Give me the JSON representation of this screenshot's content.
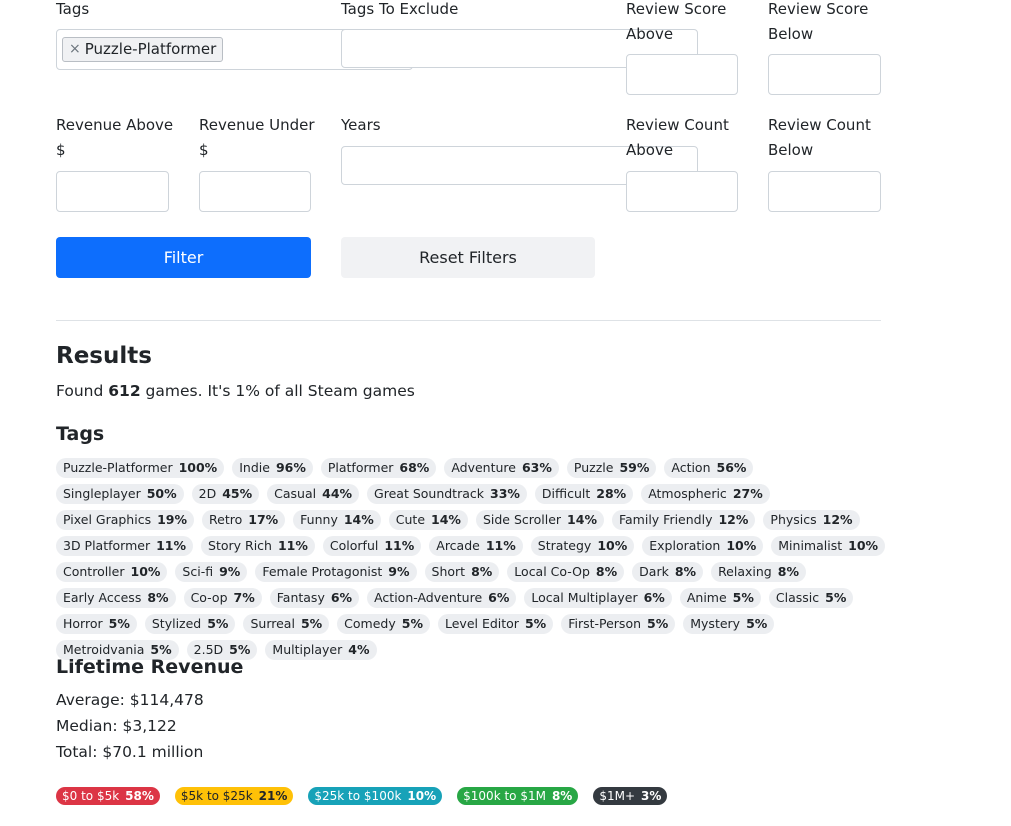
{
  "filters": {
    "tags_label": "Tags",
    "tags_chip": "Puzzle-Platformer",
    "chip_remove": "×",
    "tags_exclude_label": "Tags To Exclude",
    "review_score_above_label": "Review Score Above",
    "review_score_below_label": "Review Score Below",
    "revenue_above_label": "Revenue Above $",
    "revenue_under_label": "Revenue Under $",
    "years_label": "Years",
    "review_count_above_label": "Review Count Above",
    "review_count_below_label": "Review Count Below",
    "filter_button": "Filter",
    "reset_button": "Reset Filters"
  },
  "results": {
    "heading": "Results",
    "found_prefix": "Found ",
    "found_count": "612",
    "found_suffix": " games. It's 1% of all Steam games"
  },
  "tags_section": {
    "heading": "Tags",
    "items": [
      {
        "name": "Puzzle-Platformer",
        "pct": "100%"
      },
      {
        "name": "Indie",
        "pct": "96%"
      },
      {
        "name": "Platformer",
        "pct": "68%"
      },
      {
        "name": "Adventure",
        "pct": "63%"
      },
      {
        "name": "Puzzle",
        "pct": "59%"
      },
      {
        "name": "Action",
        "pct": "56%"
      },
      {
        "name": "Singleplayer",
        "pct": "50%"
      },
      {
        "name": "2D",
        "pct": "45%"
      },
      {
        "name": "Casual",
        "pct": "44%"
      },
      {
        "name": "Great Soundtrack",
        "pct": "33%"
      },
      {
        "name": "Difficult",
        "pct": "28%"
      },
      {
        "name": "Atmospheric",
        "pct": "27%"
      },
      {
        "name": "Pixel Graphics",
        "pct": "19%"
      },
      {
        "name": "Retro",
        "pct": "17%"
      },
      {
        "name": "Funny",
        "pct": "14%"
      },
      {
        "name": "Cute",
        "pct": "14%"
      },
      {
        "name": "Side Scroller",
        "pct": "14%"
      },
      {
        "name": "Family Friendly",
        "pct": "12%"
      },
      {
        "name": "Physics",
        "pct": "12%"
      },
      {
        "name": "3D Platformer",
        "pct": "11%"
      },
      {
        "name": "Story Rich",
        "pct": "11%"
      },
      {
        "name": "Colorful",
        "pct": "11%"
      },
      {
        "name": "Arcade",
        "pct": "11%"
      },
      {
        "name": "Strategy",
        "pct": "10%"
      },
      {
        "name": "Exploration",
        "pct": "10%"
      },
      {
        "name": "Minimalist",
        "pct": "10%"
      },
      {
        "name": "Controller",
        "pct": "10%"
      },
      {
        "name": "Sci-fi",
        "pct": "9%"
      },
      {
        "name": "Female Protagonist",
        "pct": "9%"
      },
      {
        "name": "Short",
        "pct": "8%"
      },
      {
        "name": "Local Co-Op",
        "pct": "8%"
      },
      {
        "name": "Dark",
        "pct": "8%"
      },
      {
        "name": "Relaxing",
        "pct": "8%"
      },
      {
        "name": "Early Access",
        "pct": "8%"
      },
      {
        "name": "Co-op",
        "pct": "7%"
      },
      {
        "name": "Fantasy",
        "pct": "6%"
      },
      {
        "name": "Action-Adventure",
        "pct": "6%"
      },
      {
        "name": "Local Multiplayer",
        "pct": "6%"
      },
      {
        "name": "Anime",
        "pct": "5%"
      },
      {
        "name": "Classic",
        "pct": "5%"
      },
      {
        "name": "Horror",
        "pct": "5%"
      },
      {
        "name": "Stylized",
        "pct": "5%"
      },
      {
        "name": "Surreal",
        "pct": "5%"
      },
      {
        "name": "Comedy",
        "pct": "5%"
      },
      {
        "name": "Level Editor",
        "pct": "5%"
      },
      {
        "name": "First-Person",
        "pct": "5%"
      },
      {
        "name": "Mystery",
        "pct": "5%"
      },
      {
        "name": "Metroidvania",
        "pct": "5%"
      },
      {
        "name": "2.5D",
        "pct": "5%"
      },
      {
        "name": "Multiplayer",
        "pct": "4%"
      }
    ]
  },
  "revenue": {
    "heading": "Lifetime Revenue",
    "average": "Average: $114,478",
    "median": "Median: $3,122",
    "total": "Total: $70.1 million",
    "buckets": [
      {
        "label": "$0 to $5k",
        "pct": "58%",
        "bg": "#dc3545",
        "fg": "#ffffff"
      },
      {
        "label": "$5k to $25k",
        "pct": "21%",
        "bg": "#ffc107",
        "fg": "#212529"
      },
      {
        "label": "$25k to $100k",
        "pct": "10%",
        "bg": "#17a2b8",
        "fg": "#ffffff"
      },
      {
        "label": "$100k to $1M",
        "pct": "8%",
        "bg": "#28a745",
        "fg": "#ffffff"
      },
      {
        "label": "$1M+",
        "pct": "3%",
        "bg": "#343a40",
        "fg": "#ffffff"
      }
    ]
  }
}
